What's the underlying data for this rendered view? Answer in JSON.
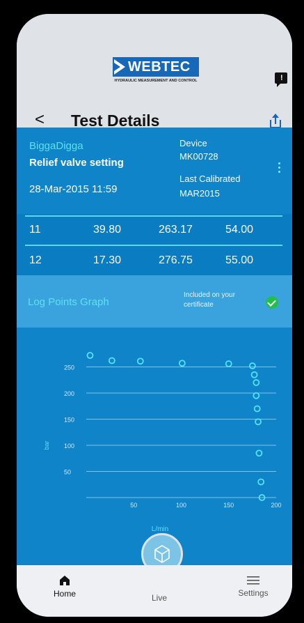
{
  "header": {
    "logo_text": "WEBTEC",
    "logo_tagline": "HYDRAULIC MEASUREMENT AND CONTROL",
    "chat_glyph": "!",
    "back_glyph": "<",
    "title": "Test Details",
    "icons": [
      "chat-icon",
      "back-icon",
      "share-icon"
    ]
  },
  "test": {
    "customer": "BiggaDigga",
    "test_type": "Relief valve setting",
    "date": "28-Mar-2015 11:59",
    "device_label": "Device",
    "device_value": "MK00728",
    "calibrated_label": "Last Calibrated",
    "calibrated_value": "MAR2015"
  },
  "rows": [
    {
      "n": "11",
      "a": "39.80",
      "b": "263.17",
      "c": "54.00"
    },
    {
      "n": "12",
      "a": "17.30",
      "b": "276.75",
      "c": "55.00"
    }
  ],
  "graph_header": {
    "title": "Log Points Graph",
    "note_line1": "Included on your",
    "note_line2": "certificate",
    "included": true
  },
  "chart_data": {
    "type": "scatter",
    "xlabel": "L/min",
    "ylabel": "bar",
    "x_ticks": [
      "50",
      "100",
      "150",
      "200"
    ],
    "y_ticks": [
      "250",
      "200",
      "150",
      "100",
      "50"
    ],
    "xlim": [
      0,
      200
    ],
    "ylim": [
      0,
      280
    ],
    "grid": true,
    "points": [
      [
        4,
        272
      ],
      [
        27,
        262
      ],
      [
        57,
        261
      ],
      [
        101,
        257
      ],
      [
        150,
        256
      ],
      [
        175,
        252
      ],
      [
        177,
        235
      ],
      [
        179,
        220
      ],
      [
        179,
        195
      ],
      [
        180,
        170
      ],
      [
        181,
        145
      ],
      [
        182,
        85
      ],
      [
        184,
        30
      ],
      [
        185,
        0
      ]
    ],
    "colors": {
      "marker": "#58e2ff",
      "grid": "#7ec3ea",
      "axis_text": "#cfe8fa",
      "label": "#5fe0f5"
    }
  },
  "nav": {
    "home": "Home",
    "live": "Live",
    "settings": "Settings"
  },
  "colors": {
    "accent": "#0f84c9",
    "brand": "#1769b8",
    "success": "#22c04a"
  }
}
